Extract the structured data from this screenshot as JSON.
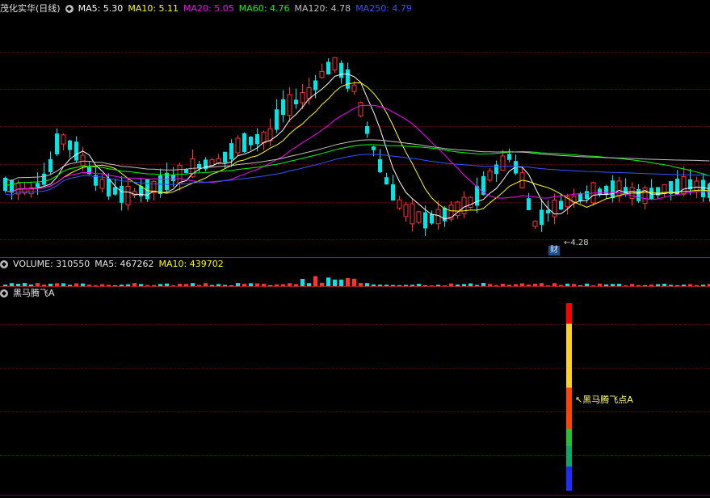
{
  "main": {
    "title": "茂化实华(日线)",
    "ma_labels": [
      {
        "text": "MA5: 5.30",
        "color": "#ffffff"
      },
      {
        "text": "MA10: 5.11",
        "color": "#ffff00"
      },
      {
        "text": "MA20: 5.05",
        "color": "#ff00ff"
      },
      {
        "text": "MA60: 4.76",
        "color": "#00ff00"
      },
      {
        "text": "MA120: 4.78",
        "color": "#c0c0c0"
      },
      {
        "text": "MA250: 4.79",
        "color": "#3355ff"
      }
    ],
    "low_label": "4.28",
    "badge": "财"
  },
  "volume": {
    "label": "VOLUME: 310550",
    "ma5": "MA5: 467262",
    "ma10": "MA10: 439702"
  },
  "indicator": {
    "name": "黑马腾飞A",
    "signal_label": "↖黑马腾飞点A"
  },
  "colors": {
    "up": "#ff3333",
    "down": "#00e5e5",
    "ma5": "#ffffff",
    "ma10": "#ffff00",
    "ma20": "#ff00ff",
    "ma60": "#00ff00",
    "ma120": "#c0c0c0",
    "ma250": "#3355ff"
  }
}
